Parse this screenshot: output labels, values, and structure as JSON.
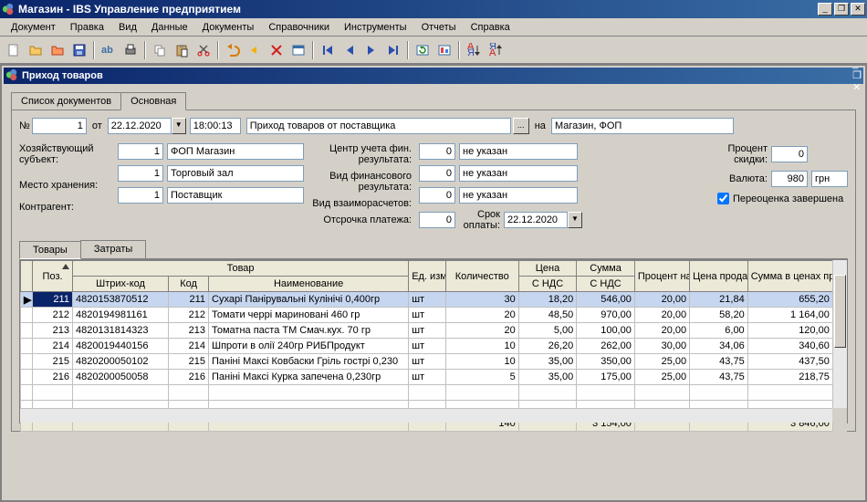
{
  "window": {
    "title": "Магазин - IBS Управление предприятием"
  },
  "menu": [
    "Документ",
    "Правка",
    "Вид",
    "Данные",
    "Документы",
    "Справочники",
    "Инструменты",
    "Отчеты",
    "Справка"
  ],
  "child": {
    "title": "Приход товаров"
  },
  "doc_tabs": {
    "list": "Список документов",
    "main": "Основная"
  },
  "form": {
    "no_label": "№",
    "no": "1",
    "ot": "от",
    "date": "22.12.2020",
    "time": "18:00:13",
    "doc_type": "Приход товаров от поставщика",
    "na": "на",
    "org": "Магазин, ФОП",
    "subject_label": "Хозяйствующий субъект:",
    "subject_code": "1",
    "subject_name": "ФОП Магазин",
    "store_label": "Место хранения:",
    "store_code": "1",
    "store_name": "Торговый зал",
    "contr_label": "Контрагент:",
    "contr_code": "1",
    "contr_name": "Поставщик",
    "fincenter_label": "Центр учета фин. результата:",
    "fincenter_code": "0",
    "fincenter_name": "не указан",
    "finres_label": "Вид финансового результата:",
    "finres_code": "0",
    "finres_name": "не указан",
    "settle_label": "Вид взаиморасчетов:",
    "settle_code": "0",
    "settle_name": "не указан",
    "defer_label": "Отсрочка платежа:",
    "defer": "0",
    "due_label": "Срок оплаты:",
    "due": "22.12.2020",
    "disc_label": "Процент скидки:",
    "disc": "0",
    "curr_label": "Валюта:",
    "curr_code": "980",
    "curr_name": "грн",
    "repriced_label": "Переоценка завершена",
    "repriced": true
  },
  "grid_tabs": {
    "goods": "Товары",
    "costs": "Затраты"
  },
  "cols": {
    "pos": "Поз.",
    "product": "Товар",
    "barcode": "Штрих-код",
    "code": "Код",
    "name": "Наименование",
    "unit": "Ед. изм.",
    "qty": "Количество",
    "price": "Цена",
    "price2": "С НДС",
    "sum": "Сумма",
    "sum2": "С НДС",
    "markup": "Процент наценки",
    "sale": "Цена продажи",
    "saletot": "Сумма в ценах продажи"
  },
  "rows": [
    {
      "pos": "211",
      "barcode": "4820153870512",
      "code": "211",
      "name": "Сухарі Панірувальні Кулінічі 0,400гр",
      "unit": "шт",
      "qty": "30",
      "price": "18,20",
      "sum": "546,00",
      "markup": "20,00",
      "sale": "21,84",
      "saletot": "655,20",
      "sel": true
    },
    {
      "pos": "212",
      "barcode": "4820194981161",
      "code": "212",
      "name": "Томати черрі мариновані 460 гр",
      "unit": "шт",
      "qty": "20",
      "price": "48,50",
      "sum": "970,00",
      "markup": "20,00",
      "sale": "58,20",
      "saletot": "1 164,00"
    },
    {
      "pos": "213",
      "barcode": "4820131814323",
      "code": "213",
      "name": "Томатна паста ТМ Смач.кух. 70 гр",
      "unit": "шт",
      "qty": "20",
      "price": "5,00",
      "sum": "100,00",
      "markup": "20,00",
      "sale": "6,00",
      "saletot": "120,00"
    },
    {
      "pos": "214",
      "barcode": "4820019440156",
      "code": "214",
      "name": "Шпроти в олії 240гр РИБПродукт",
      "unit": "шт",
      "qty": "10",
      "price": "26,20",
      "sum": "262,00",
      "markup": "30,00",
      "sale": "34,06",
      "saletot": "340,60"
    },
    {
      "pos": "215",
      "barcode": "4820200050102",
      "code": "215",
      "name": "Паніні Максі Ковбаски Гріль гострі 0,230",
      "unit": "шт",
      "qty": "10",
      "price": "35,00",
      "sum": "350,00",
      "markup": "25,00",
      "sale": "43,75",
      "saletot": "437,50"
    },
    {
      "pos": "216",
      "barcode": "4820200050058",
      "code": "216",
      "name": "Паніні Максі Курка запечена 0,230гр",
      "unit": "шт",
      "qty": "5",
      "price": "35,00",
      "sum": "175,00",
      "markup": "25,00",
      "sale": "43,75",
      "saletot": "218,75"
    }
  ],
  "totals": {
    "qty": "140",
    "sum": "3 154,00",
    "saletot": "3 846,00"
  }
}
